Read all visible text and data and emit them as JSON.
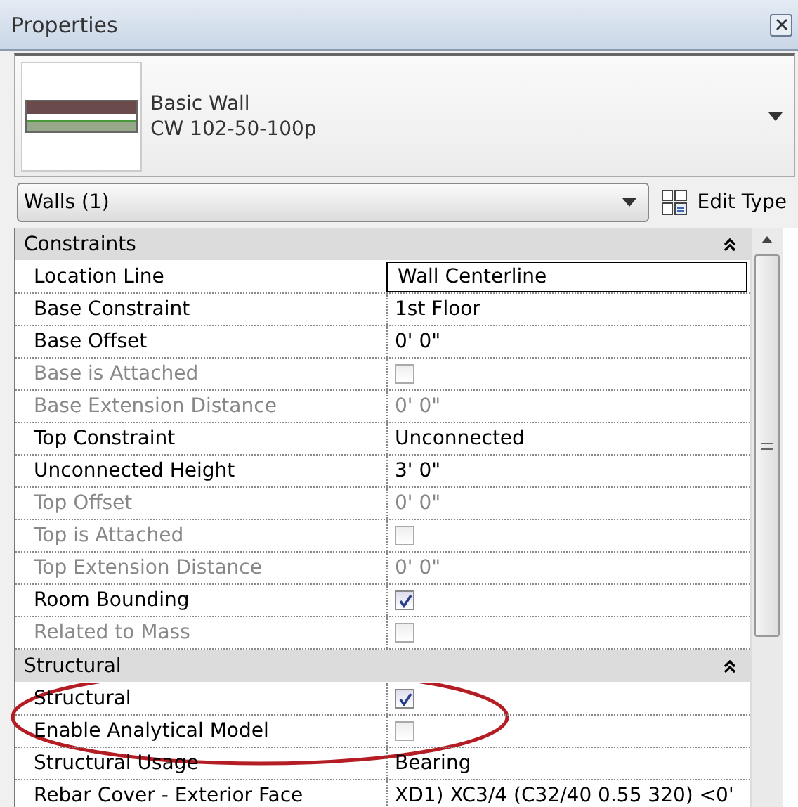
{
  "window": {
    "title": "Properties"
  },
  "type_selector": {
    "family": "Basic Wall",
    "type": "CW 102-50-100p"
  },
  "filter": {
    "value": "Walls (1)",
    "edit_type_label": "Edit Type"
  },
  "groups": [
    {
      "title": "Constraints",
      "expanded": true,
      "rows": [
        {
          "label": "Location Line",
          "kind": "text",
          "value": "Wall Centerline",
          "disabled": false,
          "selected": true
        },
        {
          "label": "Base Constraint",
          "kind": "text",
          "value": "1st Floor",
          "disabled": false,
          "selected": false
        },
        {
          "label": "Base Offset",
          "kind": "text",
          "value": "0'  0\"",
          "disabled": false,
          "selected": false
        },
        {
          "label": "Base is Attached",
          "kind": "checkbox",
          "checked": false,
          "disabled": true,
          "selected": false
        },
        {
          "label": "Base Extension Distance",
          "kind": "text",
          "value": "0'  0\"",
          "disabled": true,
          "selected": false
        },
        {
          "label": "Top Constraint",
          "kind": "text",
          "value": "Unconnected",
          "disabled": false,
          "selected": false
        },
        {
          "label": "Unconnected Height",
          "kind": "text",
          "value": "3'  0\"",
          "disabled": false,
          "selected": false
        },
        {
          "label": "Top Offset",
          "kind": "text",
          "value": "0'  0\"",
          "disabled": true,
          "selected": false
        },
        {
          "label": "Top is Attached",
          "kind": "checkbox",
          "checked": false,
          "disabled": true,
          "selected": false
        },
        {
          "label": "Top Extension Distance",
          "kind": "text",
          "value": "0'  0\"",
          "disabled": true,
          "selected": false
        },
        {
          "label": "Room Bounding",
          "kind": "checkbox",
          "checked": true,
          "disabled": false,
          "selected": false
        },
        {
          "label": "Related to Mass",
          "kind": "checkbox",
          "checked": false,
          "disabled": true,
          "selected": false
        }
      ]
    },
    {
      "title": "Structural",
      "expanded": true,
      "rows": [
        {
          "label": "Structural",
          "kind": "checkbox",
          "checked": true,
          "disabled": false,
          "selected": false
        },
        {
          "label": "Enable Analytical Model",
          "kind": "checkbox",
          "checked": false,
          "disabled": false,
          "selected": false
        },
        {
          "label": "Structural Usage",
          "kind": "text",
          "value": "Bearing",
          "disabled": false,
          "selected": false
        },
        {
          "label": "Rebar Cover - Exterior Face",
          "kind": "text",
          "value": "XD1) XC3/4 (C32/40 0.55 320) <0'",
          "disabled": false,
          "selected": false
        }
      ]
    }
  ]
}
